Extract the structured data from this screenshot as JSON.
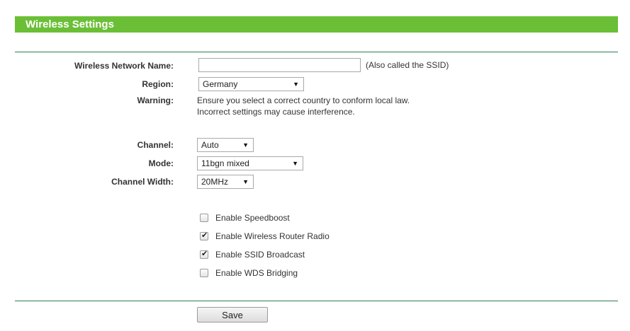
{
  "header": {
    "title": "Wireless Settings",
    "color": "#6bbf36"
  },
  "form": {
    "ssid": {
      "label": "Wireless Network Name:",
      "value": "",
      "hint": "(Also called the SSID)"
    },
    "region": {
      "label": "Region:",
      "value": "Germany"
    },
    "warning": {
      "label": "Warning:",
      "line1": "Ensure you select a correct country to conform local law.",
      "line2": "Incorrect settings may cause interference."
    },
    "channel": {
      "label": "Channel:",
      "value": "Auto"
    },
    "mode": {
      "label": "Mode:",
      "value": "11bgn mixed"
    },
    "channel_width": {
      "label": "Channel Width:",
      "value": "20MHz"
    }
  },
  "options": [
    {
      "label": "Enable Speedboost",
      "checked": false
    },
    {
      "label": "Enable Wireless Router Radio",
      "checked": true
    },
    {
      "label": "Enable SSID Broadcast",
      "checked": true
    },
    {
      "label": "Enable WDS Bridging",
      "checked": false
    }
  ],
  "save_label": "Save",
  "icons": {
    "dropdown": "triangle-down-icon",
    "check": "checkmark-icon"
  }
}
